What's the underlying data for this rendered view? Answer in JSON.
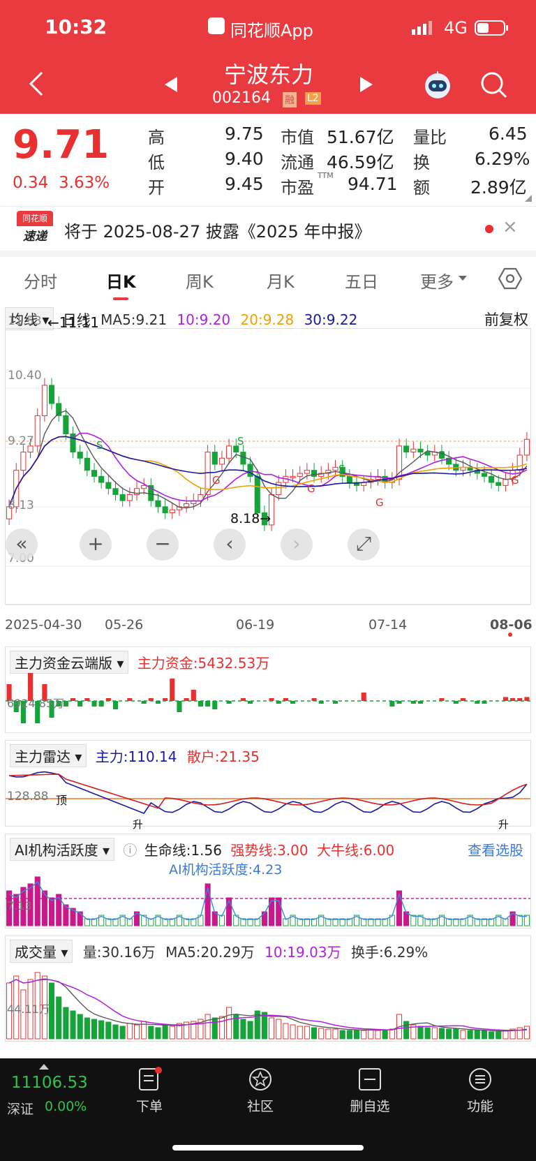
{
  "status_bar": {
    "time": "10:32",
    "app": "同花顺App",
    "network": "4G"
  },
  "stock": {
    "name": "宁波东力",
    "code": "002164",
    "tag_margin": "融",
    "tag_level": "L2"
  },
  "quote": {
    "price": "9.71",
    "change": "0.34",
    "change_pct": "3.63%",
    "high_label": "高",
    "high": "9.75",
    "low_label": "低",
    "low": "9.40",
    "open_label": "开",
    "open": "9.45",
    "mktcap_label": "市值",
    "mktcap": "51.67亿",
    "float_label": "流通",
    "float": "46.59亿",
    "pe_label": "市盈",
    "pe_sup": "TTM",
    "pe": "94.71",
    "volratio_label": "量比",
    "volratio": "6.45",
    "turnover_label": "换",
    "turnover": "6.29%",
    "amount_label": "额",
    "amount": "2.89亿"
  },
  "notice": {
    "badge_top": "同花顺",
    "badge_bottom": "速递",
    "text": "将于 2025-08-27 披露《2025 年中报》"
  },
  "tabs": [
    "分时",
    "日K",
    "周K",
    "月K",
    "五日",
    "更多"
  ],
  "kline_header": {
    "selector": "均线",
    "period": "日线",
    "ma5": "MA5:9.21",
    "ma10": "10:9.20",
    "ma20": "20:9.28",
    "ma30": "30:9.22",
    "adjust": "前复权"
  },
  "kline": {
    "y_ticks": [
      "11.53",
      "10.40",
      "9.27",
      "8.13",
      "7.00"
    ],
    "max_marker": "←11.11",
    "min_marker": "8.18→",
    "dates": [
      "2025-04-30",
      "05-26",
      "06-19",
      "07-14",
      "08-06"
    ]
  },
  "panel1": {
    "selector": "主力资金云端版",
    "value": "主力资金:5432.53万",
    "axis": "6924.85万"
  },
  "panel2": {
    "selector": "主力雷达",
    "main": "主力:110.14",
    "retail": "散户:21.35",
    "axis": "128.88",
    "top_mark": "顶",
    "rise_mark": "升",
    "rise_mark2": "升"
  },
  "panel3": {
    "selector": "AI机构活跃度",
    "life": "生命线:1.56",
    "strong": "强势线:3.00",
    "bull": "大牛线:6.00",
    "link": "查看选股",
    "active": "AI机构活跃度:4.23",
    "axis": "7.13"
  },
  "panel4": {
    "selector": "成交量",
    "vol": "量:30.16万",
    "ma5": "MA5:20.29万",
    "ma10": "10:19.03万",
    "turnover": "换手:6.29%",
    "axis": "44.11万"
  },
  "bottom": {
    "index_value": "11106.53",
    "index_name": "深证",
    "index_change": "0.00%",
    "nav": [
      "下单",
      "社区",
      "删自选",
      "功能"
    ]
  },
  "colors": {
    "header": "#e93a3f",
    "up": "#e93030",
    "down": "#16a33a",
    "ma5": "#333333",
    "ma10": "#b020e0",
    "ma20": "#f0a000",
    "ma30": "#1a1aa0"
  }
}
